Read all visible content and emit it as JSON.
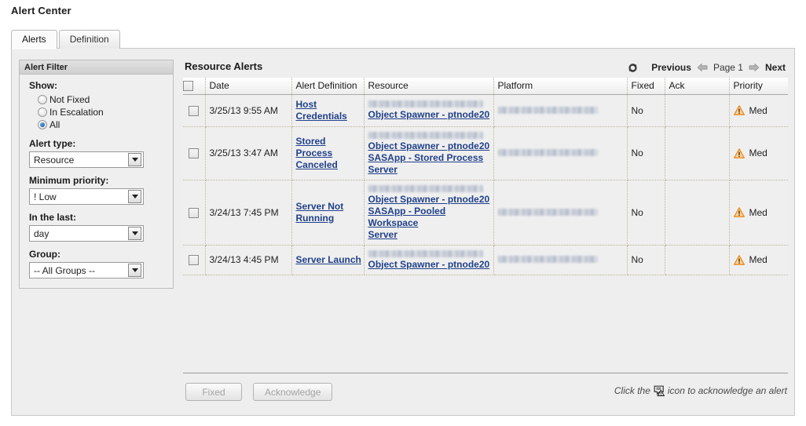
{
  "page_title": "Alert Center",
  "tabs": [
    {
      "label": "Alerts",
      "active": true
    },
    {
      "label": "Definition",
      "active": false
    }
  ],
  "filter": {
    "header": "Alert Filter",
    "show_label": "Show:",
    "show_options": [
      {
        "label": "Not Fixed",
        "selected": false
      },
      {
        "label": "In Escalation",
        "selected": false
      },
      {
        "label": "All",
        "selected": true
      }
    ],
    "alert_type_label": "Alert type:",
    "alert_type_value": "Resource",
    "min_priority_label": "Minimum priority:",
    "min_priority_value": "! Low",
    "in_the_last_label": "In the last:",
    "in_the_last_value": "day",
    "group_label": "Group:",
    "group_value": "-- All Groups --"
  },
  "main": {
    "title": "Resource Alerts",
    "pager": {
      "refresh_icon": "refresh-icon",
      "previous_label": "Previous",
      "prev_arrow_icon": "arrow-left-icon",
      "page_label": "Page 1",
      "next_arrow_icon": "arrow-right-icon",
      "next_label": "Next"
    },
    "columns": [
      "",
      "Date",
      "Alert Definition",
      "Resource",
      "Platform",
      "Fixed",
      "Ack",
      "Priority"
    ],
    "rows": [
      {
        "date": "3/25/13 9:55 AM",
        "alert_definition": [
          "Host",
          "Credentials"
        ],
        "resource_redacted": true,
        "resource_links": [
          "Object Spawner - ptnode20"
        ],
        "platform_redacted": true,
        "fixed": "No",
        "ack": "",
        "priority": "Med",
        "priority_icon": "warning-triangle-icon"
      },
      {
        "date": "3/25/13 3:47 AM",
        "alert_definition": [
          "Stored Process",
          "Canceled"
        ],
        "resource_redacted": true,
        "resource_links": [
          "Object Spawner - ptnode20",
          "SASApp - Stored Process",
          "Server"
        ],
        "platform_redacted": true,
        "fixed": "No",
        "ack": "",
        "priority": "Med",
        "priority_icon": "warning-triangle-icon"
      },
      {
        "date": "3/24/13 7:45 PM",
        "alert_definition": [
          "Server Not",
          "Running"
        ],
        "resource_redacted": true,
        "resource_links": [
          "Object Spawner - ptnode20",
          "SASApp - Pooled Workspace",
          "Server"
        ],
        "platform_redacted": true,
        "fixed": "No",
        "ack": "",
        "priority": "Med",
        "priority_icon": "warning-triangle-icon"
      },
      {
        "date": "3/24/13 4:45 PM",
        "alert_definition": [
          "Server Launch"
        ],
        "resource_redacted": true,
        "resource_links": [
          "Object Spawner - ptnode20"
        ],
        "platform_redacted": true,
        "fixed": "No",
        "ack": "",
        "priority": "Med",
        "priority_icon": "warning-triangle-icon"
      }
    ]
  },
  "footer": {
    "fixed_button": "Fixed",
    "acknowledge_button": "Acknowledge",
    "hint_prefix": "Click the",
    "hint_icon": "acknowledge-alert-icon",
    "hint_suffix": "icon to acknowledge an alert"
  },
  "colors": {
    "link": "#21418a",
    "warning": "#e98b1f",
    "panel_bg": "#eeeeee",
    "header_bg": "#d3d3d3"
  }
}
